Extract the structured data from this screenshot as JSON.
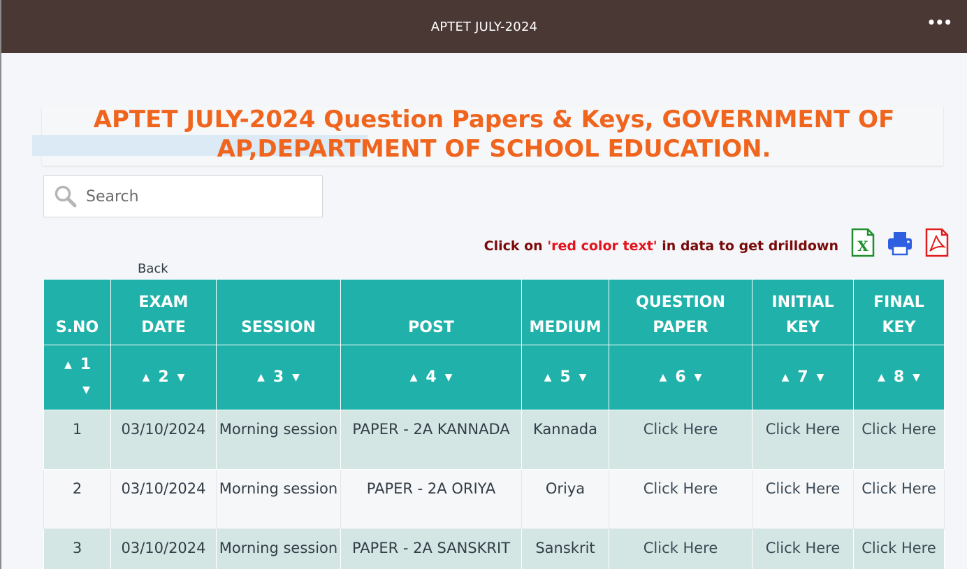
{
  "topbar": {
    "title": "APTET JULY-2024",
    "menu_icon": "more-horizontal-icon"
  },
  "page_title": "APTET JULY-2024 Question Papers & Keys, GOVERNMENT OF AP,DEPARTMENT OF SCHOOL EDUCATION.",
  "search": {
    "placeholder": "Search",
    "value": ""
  },
  "drill_note": {
    "prefix": "Click on ",
    "highlight": "'red color text'",
    "suffix": " in data to get drilldown"
  },
  "export_icons": [
    "excel-icon",
    "print-icon",
    "pdf-icon"
  ],
  "back_label": "Back",
  "table": {
    "headers": [
      "S.NO",
      "EXAM DATE",
      "SESSION",
      "POST",
      "MEDIUM",
      "QUESTION PAPER",
      "INITIAL KEY",
      "FINAL KEY"
    ],
    "sort_numbers": [
      "1",
      "2",
      "3",
      "4",
      "5",
      "6",
      "7",
      "8"
    ],
    "rows": [
      {
        "sno": "1",
        "date": "03/10/2024",
        "session": "Morning session",
        "post": "PAPER - 2A KANNADA",
        "medium": "Kannada",
        "qp": "Click Here",
        "ik": "Click Here",
        "fk": "Click Here"
      },
      {
        "sno": "2",
        "date": "03/10/2024",
        "session": "Morning session",
        "post": "PAPER - 2A ORIYA",
        "medium": "Oriya",
        "qp": "Click Here",
        "ik": "Click Here",
        "fk": "Click Here"
      },
      {
        "sno": "3",
        "date": "03/10/2024",
        "session": "Morning session",
        "post": "PAPER - 2A SANSKRIT",
        "medium": "Sanskrit",
        "qp": "Click Here",
        "ik": "Click Here",
        "fk": "Click Here"
      }
    ]
  },
  "colors": {
    "topbar": "#4a3835",
    "title": "#f0651e",
    "table_header": "#20b2aa",
    "row_odd": "#d3e6e4",
    "drill_text": "#7a0a0a",
    "drill_red": "#e4121b"
  }
}
